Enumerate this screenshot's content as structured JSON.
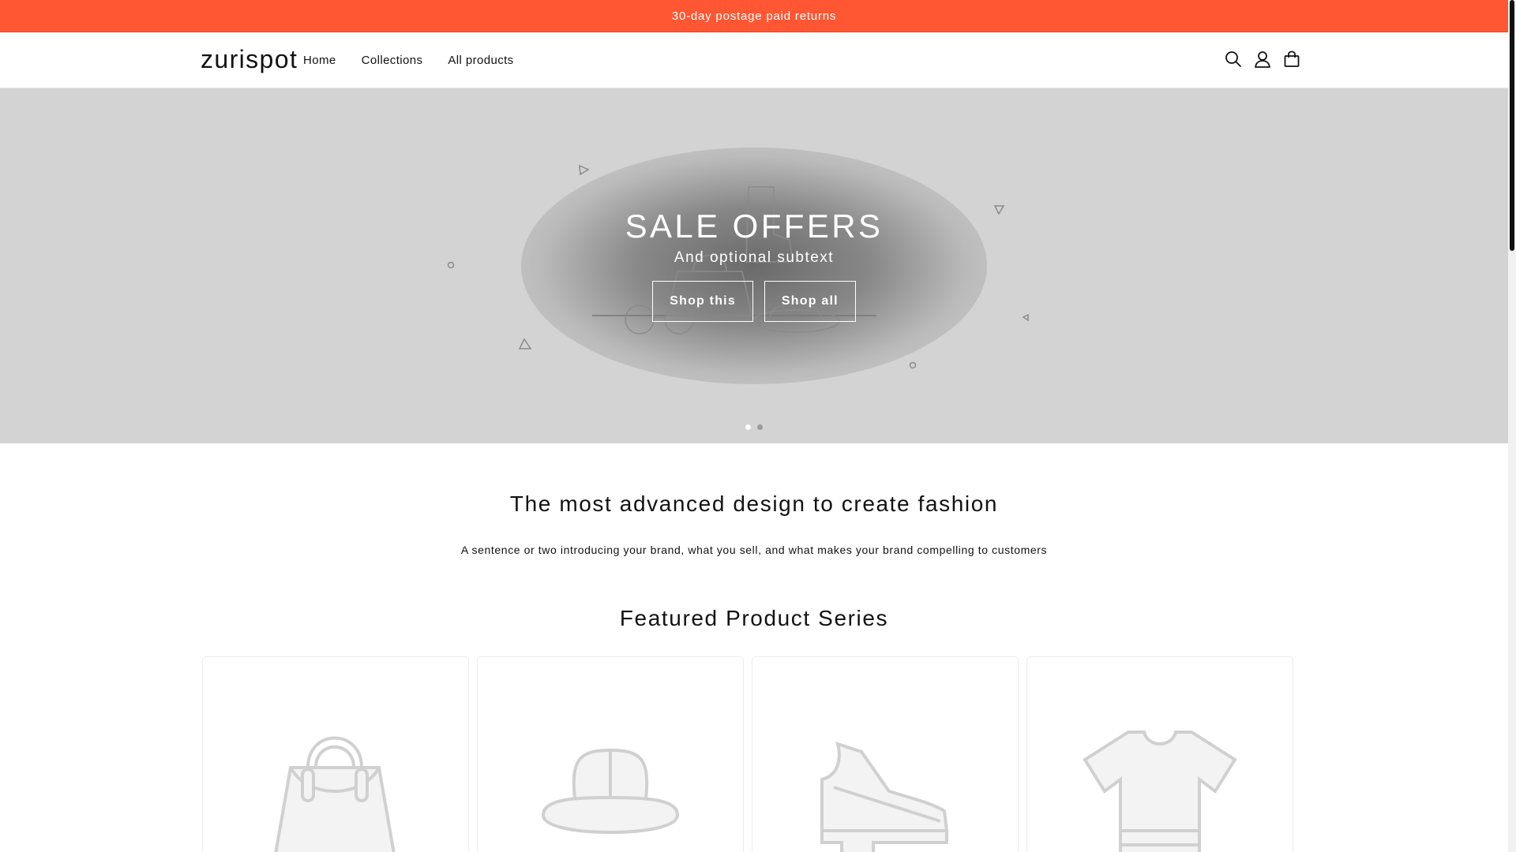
{
  "announcement": {
    "text": "30-day postage paid returns"
  },
  "header": {
    "logo": "zurispot",
    "nav": [
      {
        "label": "Home"
      },
      {
        "label": "Collections"
      },
      {
        "label": "All products"
      }
    ],
    "icons": [
      "search-icon",
      "account-icon",
      "cart-icon"
    ]
  },
  "hero": {
    "title": "SALE OFFERS",
    "subtitle": "And optional subtext",
    "buttons": [
      {
        "label": "Shop this"
      },
      {
        "label": "Shop all"
      }
    ],
    "slides": {
      "count": 2,
      "active": 1
    }
  },
  "intro": {
    "heading": "The most advanced design to create fashion",
    "text": "A sentence or two introducing your brand, what you sell, and what makes your brand compelling to customers"
  },
  "featured": {
    "heading": "Featured Product Series",
    "cards": [
      {
        "icon": "handbag-icon"
      },
      {
        "icon": "hat-icon"
      },
      {
        "icon": "shoe-icon"
      },
      {
        "icon": "tshirt-icon"
      }
    ]
  },
  "colors": {
    "announcement_bg": "#ff5733",
    "hero_bg": "#d3d3d3",
    "text": "#121212"
  }
}
